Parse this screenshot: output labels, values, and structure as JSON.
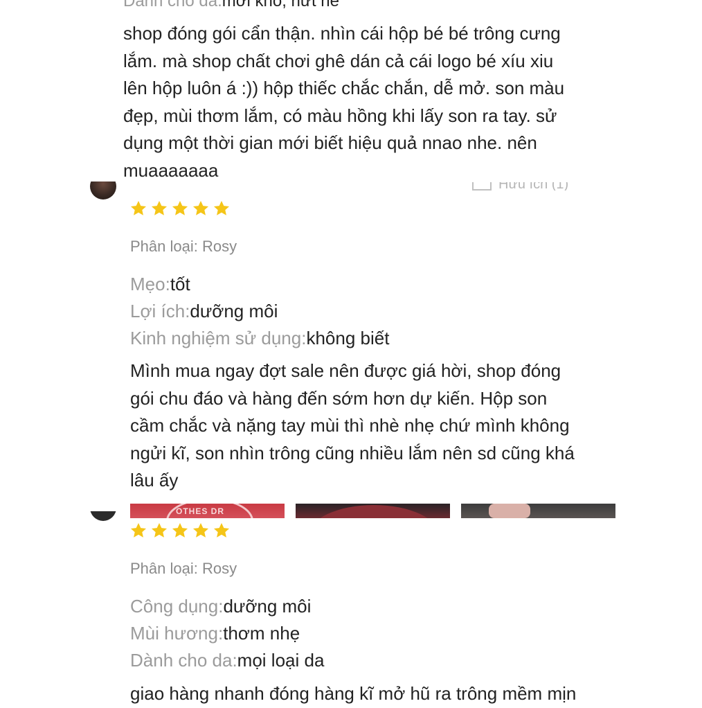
{
  "review1": {
    "cut_attr_label": "Dành cho da:",
    "cut_attr_value": "mới khô, nứt nẻ",
    "text": "shop đóng gói cẩn thận. nhìn cái hộp bé bé trông cưng\nlắm. mà shop chất chơi ghê dán cả cái logo bé xíu xiu\nlên hộp luôn á :)) hộp thiếc chắc chắn, dễ mở. son màu\nđẹp, mùi thơm lắm, có màu hồng khi lấy son ra tay. sử\ndụng một thời gian mới biết hiệu quả nnao nhe. nên\nmuaaaaaaa",
    "helpful_label": "Hữu ích (1)"
  },
  "review2": {
    "rating": 5,
    "variant": "Phân loại: Rosy",
    "attrs": [
      {
        "label": "Mẹo:",
        "value": "tốt"
      },
      {
        "label": "Lợi ích:",
        "value": "dưỡng môi"
      },
      {
        "label": "Kinh nghiệm sử dụng:",
        "value": "không biết"
      }
    ],
    "text": "Mình mua ngay đợt sale nên được giá hời, shop đóng\ngói chu đáo và hàng đến sớm hơn dự kiến. Hộp son\ncầm chắc và nặng tay mùi thì nhè nhẹ chứ mình không\nngửi kĩ, son nhìn trông cũng nhiều lắm nên sd cũng khá\nlâu ấy",
    "thumb_text": "OTHES DR"
  },
  "review3": {
    "rating": 5,
    "variant": "Phân loại: Rosy",
    "attrs": [
      {
        "label": "Công dụng:",
        "value": "dưỡng môi"
      },
      {
        "label": "Mùi hương:",
        "value": "thơm nhẹ"
      },
      {
        "label": "Dành cho da:",
        "value": "mọi loại da"
      }
    ],
    "text": "giao hàng nhanh đóng hàng kĩ mở hũ ra trông mềm mịn"
  },
  "colors": {
    "star": "#f5c518",
    "muted": "#9b9b9b",
    "text": "#222222"
  },
  "icons": {
    "star": "star-icon",
    "helpful": "thumbs-up-icon"
  }
}
